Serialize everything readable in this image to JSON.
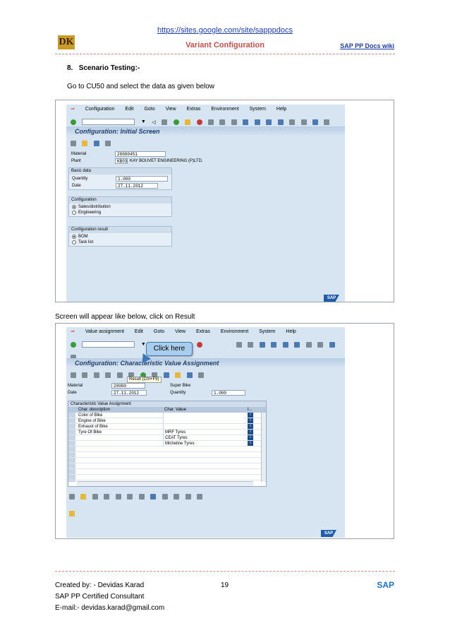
{
  "header": {
    "url": "https://sites.google.com/site/sapppdocs",
    "logo_text": "DK",
    "title": "Variant Configuration",
    "wiki_link": "SAP PP Docs wiki"
  },
  "section": {
    "number": "8.",
    "title": "Scenario Testing:-",
    "instruction1": "Go to CU50 and select the data as given below",
    "instruction2": "Screen will appear like below, click on Result"
  },
  "screenshot1": {
    "menu": [
      "Configuration",
      "Edit",
      "Goto",
      "View",
      "Extras",
      "Environment",
      "System",
      "Help"
    ],
    "screen_title": "Configuration: Initial Screen",
    "fields": {
      "material_label": "Material",
      "material_value": "20000451",
      "plant_label": "Plant",
      "plant_value": "KB03",
      "plant_desc": "KAY BOUVET ENGINEERING (P)LTD."
    },
    "basic_data": {
      "title": "Basic data",
      "quantity_label": "Quantity",
      "quantity_value": "1.000",
      "date_label": "Date",
      "date_value": "27.11.2012"
    },
    "configuration": {
      "title": "Configuration",
      "options": [
        "Sales/distribution",
        "Engineering"
      ],
      "selected": 0
    },
    "configuration_result": {
      "title": "Configuration result",
      "options": [
        "BOM",
        "Task list"
      ],
      "selected": 0
    },
    "sap_logo": "SAP"
  },
  "screenshot2": {
    "menu": [
      "Value assignment",
      "Edit",
      "Goto",
      "View",
      "Extras",
      "Environment",
      "System",
      "Help"
    ],
    "screen_title": "Configuration: Characteristic Value Assignment",
    "tooltip": "Result   (Ctrl+F9)",
    "callout": "Click here",
    "material_label": "Material",
    "material_value": "20000",
    "material_desc": "Super Bike",
    "date_label": "Date",
    "date_value": "27.11.2012",
    "quantity_label": "Quantity",
    "quantity_value": "1.000",
    "table": {
      "title": "Characteristic Value Assignment",
      "headers": [
        "Char. description",
        "Char. Value",
        "I..."
      ],
      "rows": [
        {
          "desc": "Color of Bike",
          "value": ""
        },
        {
          "desc": "Engine of Bike",
          "value": ""
        },
        {
          "desc": "Exhaust of Bike",
          "value": ""
        },
        {
          "desc": "Tyre Of Bike",
          "value": "MRF Tyres"
        },
        {
          "desc": "",
          "value": "CEAT Tyres"
        },
        {
          "desc": "",
          "value": "Micheline Tyres"
        }
      ]
    },
    "sap_logo": "SAP"
  },
  "footer": {
    "created_by": "Created by: - Devidas Karad",
    "page": "19",
    "sap_text": "SAP",
    "certified": "SAP PP Certified Consultant",
    "email": "E-mail:- devidas.karad@gmail.com"
  }
}
